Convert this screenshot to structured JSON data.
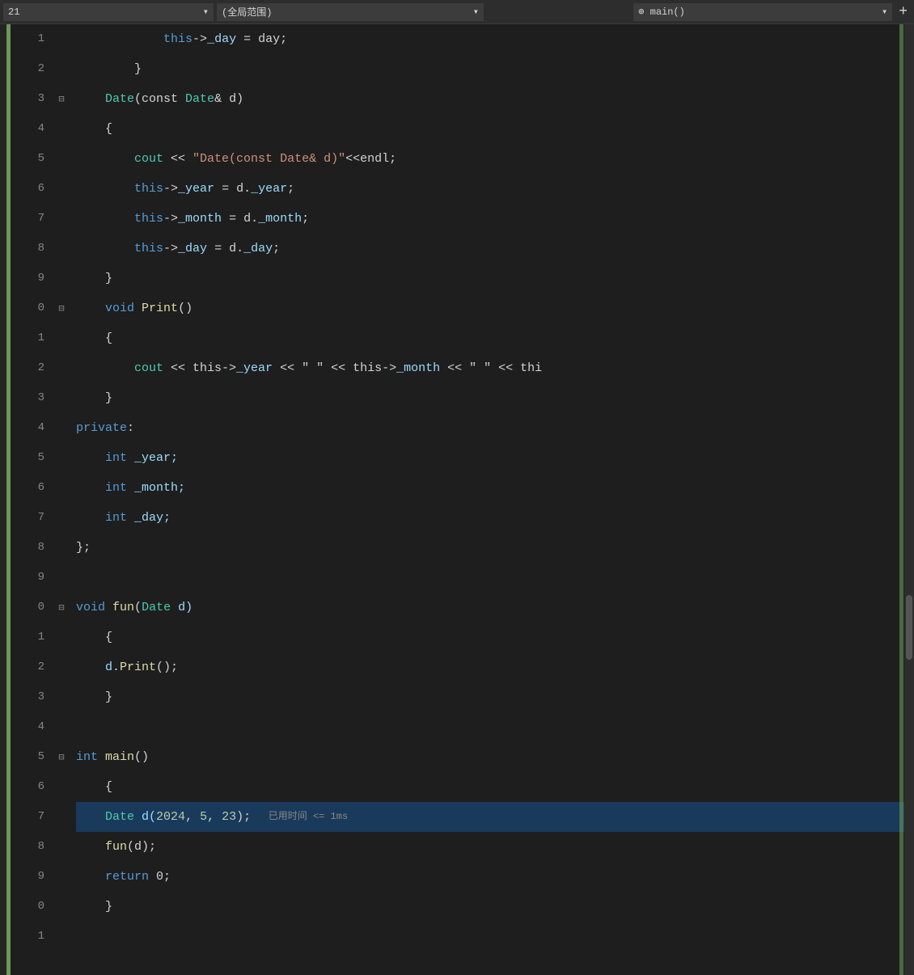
{
  "topbar": {
    "dropdown1": "21",
    "dropdown2": "(全局范围)",
    "dropdown3": "⊕ main()",
    "plus_label": "+"
  },
  "lines": [
    {
      "num": "1",
      "indent": 4,
      "fold": false,
      "content": [
        {
          "t": "            this->",
          "cls": "kw2 white"
        },
        {
          "t": "_day",
          "cls": "lt-blue"
        },
        {
          "t": " = day;",
          "cls": "white"
        }
      ]
    },
    {
      "num": "2",
      "indent": 3,
      "fold": false,
      "content": [
        {
          "t": "        }",
          "cls": "white"
        }
      ]
    },
    {
      "num": "3",
      "indent": 2,
      "fold": true,
      "content": [
        {
          "t": "    ",
          "cls": ""
        },
        {
          "t": "Date",
          "cls": "type"
        },
        {
          "t": "(const ",
          "cls": "white"
        },
        {
          "t": "Date",
          "cls": "type"
        },
        {
          "t": "& d)",
          "cls": "white"
        }
      ]
    },
    {
      "num": "4",
      "indent": 2,
      "fold": false,
      "content": [
        {
          "t": "    {",
          "cls": "white"
        }
      ]
    },
    {
      "num": "5",
      "indent": 3,
      "fold": false,
      "content": [
        {
          "t": "        cout << \"Date(const Date& d)\"<<endl;",
          "cls": "white"
        }
      ]
    },
    {
      "num": "6",
      "indent": 3,
      "fold": false,
      "content": [
        {
          "t": "        this->",
          "cls": "kw2 white"
        },
        {
          "t": "_year",
          "cls": "lt-blue"
        },
        {
          "t": " = d.",
          "cls": "white"
        },
        {
          "t": "_year",
          "cls": "lt-blue"
        },
        {
          "t": ";",
          "cls": "white"
        }
      ]
    },
    {
      "num": "7",
      "indent": 3,
      "fold": false,
      "content": [
        {
          "t": "        this->",
          "cls": "kw2 white"
        },
        {
          "t": "_month",
          "cls": "lt-blue"
        },
        {
          "t": " = d.",
          "cls": "white"
        },
        {
          "t": "_month",
          "cls": "lt-blue"
        },
        {
          "t": ";",
          "cls": "white"
        }
      ]
    },
    {
      "num": "8",
      "indent": 3,
      "fold": false,
      "content": [
        {
          "t": "        this->",
          "cls": "kw2 white"
        },
        {
          "t": "_day",
          "cls": "lt-blue"
        },
        {
          "t": " = d.",
          "cls": "white"
        },
        {
          "t": "_day",
          "cls": "lt-blue"
        },
        {
          "t": ";",
          "cls": "white"
        }
      ]
    },
    {
      "num": "9",
      "indent": 2,
      "fold": false,
      "content": [
        {
          "t": "    }",
          "cls": "white"
        }
      ]
    },
    {
      "num": "0",
      "indent": 2,
      "fold": true,
      "content": [
        {
          "t": "    ",
          "cls": ""
        },
        {
          "t": "void",
          "cls": "blue"
        },
        {
          "t": " Print()",
          "cls": "yellow white"
        }
      ]
    },
    {
      "num": "1",
      "indent": 2,
      "fold": false,
      "content": [
        {
          "t": "    {",
          "cls": "white"
        }
      ]
    },
    {
      "num": "2",
      "indent": 3,
      "fold": false,
      "content": [
        {
          "t": "        cout << this->",
          "cls": "cyan white"
        },
        {
          "t": "_year",
          "cls": "lt-blue"
        },
        {
          "t": " << \" \" << this->",
          "cls": "white lt-blue white"
        },
        {
          "t": "_month",
          "cls": "lt-blue"
        },
        {
          "t": " << \" \" << thi",
          "cls": "white"
        }
      ]
    },
    {
      "num": "3",
      "indent": 2,
      "fold": false,
      "content": [
        {
          "t": "    }",
          "cls": "white"
        }
      ]
    },
    {
      "num": "4",
      "indent": 1,
      "fold": false,
      "content": [
        {
          "t": "private:",
          "cls": "blue white"
        }
      ]
    },
    {
      "num": "5",
      "indent": 2,
      "fold": false,
      "content": [
        {
          "t": "    int",
          "cls": "blue"
        },
        {
          "t": " _year;",
          "cls": "lt-blue white"
        }
      ]
    },
    {
      "num": "6",
      "indent": 2,
      "fold": false,
      "content": [
        {
          "t": "    int",
          "cls": "blue"
        },
        {
          "t": " _month;",
          "cls": "lt-blue white"
        }
      ]
    },
    {
      "num": "7",
      "indent": 2,
      "fold": false,
      "content": [
        {
          "t": "    int",
          "cls": "blue"
        },
        {
          "t": " _day;",
          "cls": "lt-blue white"
        }
      ]
    },
    {
      "num": "8",
      "indent": 1,
      "fold": false,
      "content": [
        {
          "t": "};",
          "cls": "white"
        }
      ]
    },
    {
      "num": "9",
      "indent": 0,
      "fold": false,
      "content": []
    },
    {
      "num": "0",
      "indent": 0,
      "fold": true,
      "content": [
        {
          "t": "void",
          "cls": "blue"
        },
        {
          "t": " fun(",
          "cls": "yellow white"
        },
        {
          "t": "Date",
          "cls": "type"
        },
        {
          "t": " d)",
          "cls": "lt-blue white"
        }
      ]
    },
    {
      "num": "1",
      "indent": 1,
      "fold": false,
      "content": [
        {
          "t": "{",
          "cls": "white"
        }
      ]
    },
    {
      "num": "2",
      "indent": 2,
      "fold": false,
      "content": [
        {
          "t": "    d.",
          "cls": "lt-blue white"
        },
        {
          "t": "Print",
          "cls": "yellow"
        },
        {
          "t": "();",
          "cls": "white"
        }
      ]
    },
    {
      "num": "3",
      "indent": 1,
      "fold": false,
      "content": [
        {
          "t": "}",
          "cls": "white"
        }
      ]
    },
    {
      "num": "4",
      "indent": 0,
      "fold": false,
      "content": []
    },
    {
      "num": "5",
      "indent": 0,
      "fold": true,
      "content": [
        {
          "t": "int",
          "cls": "blue"
        },
        {
          "t": " main()",
          "cls": "yellow white"
        }
      ]
    },
    {
      "num": "6",
      "indent": 1,
      "fold": false,
      "content": [
        {
          "t": "{",
          "cls": "white"
        }
      ]
    },
    {
      "num": "7",
      "indent": 2,
      "fold": false,
      "debug": true,
      "content": [
        {
          "t": "    ",
          "cls": ""
        },
        {
          "t": "Date",
          "cls": "type"
        },
        {
          "t": " d(",
          "cls": "white lt-blue white"
        },
        {
          "t": "2024",
          "cls": "num"
        },
        {
          "t": ", ",
          "cls": "white"
        },
        {
          "t": "5",
          "cls": "num"
        },
        {
          "t": ", ",
          "cls": "white"
        },
        {
          "t": "23",
          "cls": "num"
        },
        {
          "t": ");",
          "cls": "white"
        },
        {
          "t": "   已用时间 <= 1ms",
          "cls": "debug-hint-inline"
        }
      ]
    },
    {
      "num": "8",
      "indent": 2,
      "fold": false,
      "content": [
        {
          "t": "    fun(d);",
          "cls": "yellow white"
        }
      ]
    },
    {
      "num": "9",
      "indent": 2,
      "fold": false,
      "content": [
        {
          "t": "    return 0;",
          "cls": "blue white"
        }
      ]
    },
    {
      "num": "0",
      "indent": 1,
      "fold": false,
      "content": [
        {
          "t": "}",
          "cls": "white"
        }
      ]
    },
    {
      "num": "1",
      "indent": 0,
      "fold": false,
      "content": []
    }
  ]
}
